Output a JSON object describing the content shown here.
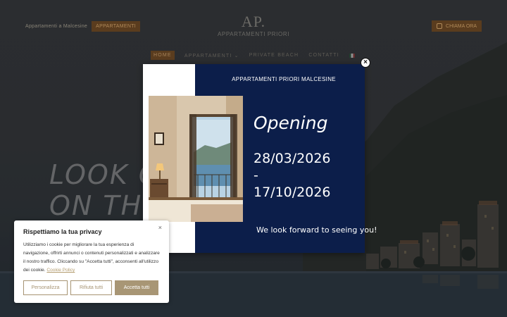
{
  "header": {
    "left_link": "Appartamenti a Malcesine",
    "left_button": "APPARTAMENTI",
    "logo_mark": "AP.",
    "logo_sub": "APPARTAMENTI PRIORI",
    "call_button": "CHIAMA ORA",
    "call_icon": "phone-icon"
  },
  "nav": {
    "items": [
      "HOME",
      "APPARTAMENTI",
      "PRIVATE BEACH",
      "CONTATTI"
    ],
    "active": "HOME",
    "chevron": "⌄",
    "lang_icon": "flag-it-icon"
  },
  "hero": {
    "line1": "LOOK O",
    "line2": "ON TH"
  },
  "popup": {
    "brand": "APPARTAMENTI PRIORI MALCESINE",
    "heading": "Opening",
    "date_start": "28/03/2026",
    "date_sep": "-",
    "date_end": "17/10/2026",
    "footer": "We look forward to seeing you!",
    "close_icon": "close-icon",
    "close_glyph": "×"
  },
  "cookie": {
    "title": "Rispettiamo la tua privacy",
    "close_glyph": "×",
    "text": "Utilizziamo i cookie per migliorare la tua esperienza di navigazione, offrirti annunci o contenuti personalizzati e analizzare il nostro traffico. Cliccando su \"Accetta tutti\", acconsenti all'utilizzo dei cookie.",
    "link": "Cookie Policy",
    "buttons": {
      "customize": "Personalizza",
      "reject": "Rifiuta tutti",
      "accept": "Accetta tutti"
    }
  },
  "colors": {
    "popup_bg": "#0c1e4a",
    "accent": "#a89675",
    "nav_accent": "#5a3c1e"
  }
}
